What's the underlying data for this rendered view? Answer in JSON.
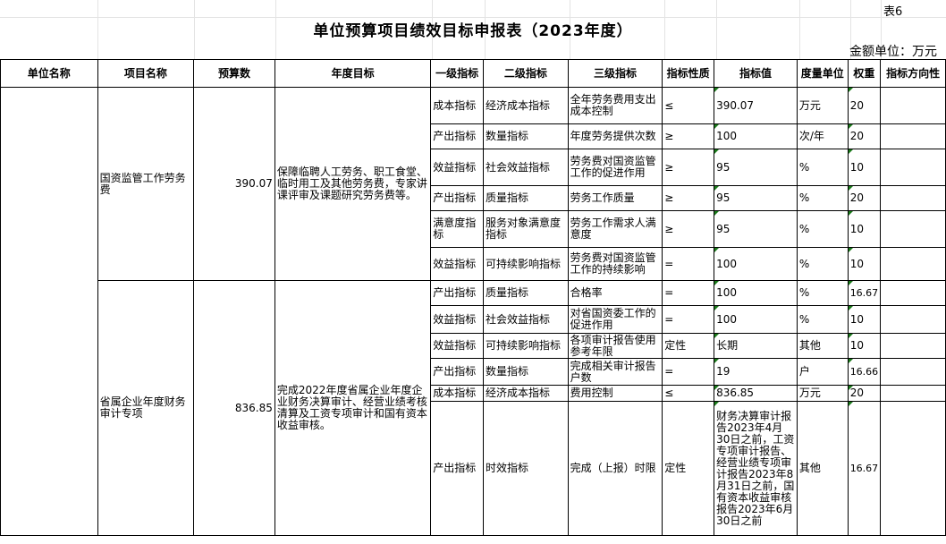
{
  "sheet_no": "表6",
  "title": "单位预算项目绩效目标申报表（2023年度）",
  "unit": "金额单位：万元",
  "headers": [
    "单位名称",
    "项目名称",
    "预算数",
    "年度目标",
    "一级指标",
    "二级指标",
    "三级指标",
    "指标性质",
    "指标值",
    "度量单位",
    "权重",
    "指标方向性"
  ],
  "projects": [
    {
      "name": "国资监管工作劳务费",
      "budget": "390.07",
      "goal": "保障临聘人工劳务、职工食堂、临时用工及其他劳务费，专家讲课评审及课题研究劳务费等。",
      "rows": [
        {
          "l1": "成本指标",
          "l2": "经济成本指标",
          "l3": "全年劳务费用支出成本控制",
          "nature": "≤",
          "value": "390.07",
          "unit": "万元",
          "weight": "20",
          "dir": ""
        },
        {
          "l1": "产出指标",
          "l2": "数量指标",
          "l3": "年度劳务提供次数",
          "nature": "≥",
          "value": "100",
          "unit": "次/年",
          "weight": "20",
          "dir": ""
        },
        {
          "l1": "效益指标",
          "l2": "社会效益指标",
          "l3": "劳务费对国资监管工作的促进作用",
          "nature": "≥",
          "value": "95",
          "unit": "%",
          "weight": "10",
          "dir": ""
        },
        {
          "l1": "产出指标",
          "l2": "质量指标",
          "l3": "劳务工作质量",
          "nature": "≥",
          "value": "95",
          "unit": "%",
          "weight": "20",
          "dir": ""
        },
        {
          "l1": "满意度指标",
          "l2": "服务对象满意度指标",
          "l3": "劳务工作需求人满意度",
          "nature": "≥",
          "value": "95",
          "unit": "%",
          "weight": "10",
          "dir": ""
        },
        {
          "l1": "效益指标",
          "l2": "可持续影响指标",
          "l3": "劳务费对国资监管工作的持续影响",
          "nature": "=",
          "value": "100",
          "unit": "%",
          "weight": "10",
          "dir": ""
        }
      ]
    },
    {
      "name": "省属企业年度财务审计专项",
      "budget": "836.85",
      "goal": "完成2022年度省属企业年度企业财务决算审计、经营业绩考核清算及工资专项审计和国有资本收益审核。",
      "rows": [
        {
          "l1": "产出指标",
          "l2": "质量指标",
          "l3": "合格率",
          "nature": "=",
          "value": "100",
          "unit": "%",
          "weight": "16.67",
          "dir": ""
        },
        {
          "l1": "效益指标",
          "l2": "社会效益指标",
          "l3": "对省国资委工作的促进作用",
          "nature": "=",
          "value": "100",
          "unit": "%",
          "weight": "10",
          "dir": ""
        },
        {
          "l1": "效益指标",
          "l2": "可持续影响指标",
          "l3": "各项审计报告使用参考年限",
          "nature": "定性",
          "value": "长期",
          "unit": "其他",
          "weight": "10",
          "dir": ""
        },
        {
          "l1": "产出指标",
          "l2": "数量指标",
          "l3": "完成相关审计报告户数",
          "nature": "=",
          "value": "19",
          "unit": "户",
          "weight": "16.66",
          "dir": ""
        },
        {
          "l1": "成本指标",
          "l2": "经济成本指标",
          "l3": "费用控制",
          "nature": "≤",
          "value": "836.85",
          "unit": "万元",
          "weight": "20",
          "dir": ""
        },
        {
          "l1": "产出指标",
          "l2": "时效指标",
          "l3": "完成（上报）时限",
          "nature": "定性",
          "value": "财务决算审计报告2023年4月30日之前，工资专项审计报告、经营业绩专项审计报告2023年8月31日之前，国有资本收益审核报告2023年6月30日之前",
          "unit": "其他",
          "weight": "16.67",
          "dir": ""
        }
      ]
    }
  ]
}
